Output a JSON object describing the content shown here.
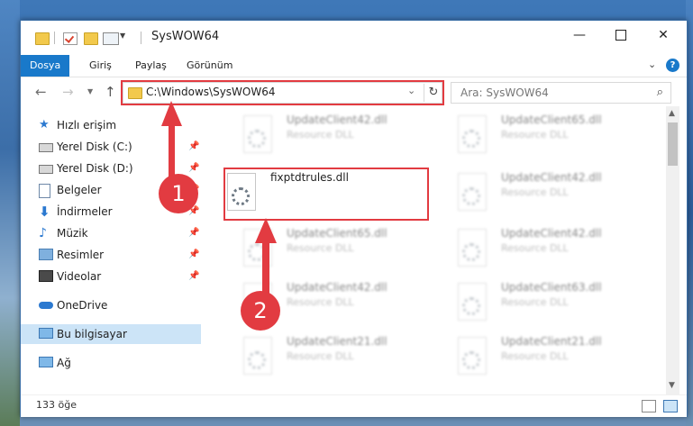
{
  "window": {
    "title": "SysWOW64",
    "minimize_icon": "minimize-icon",
    "maximize_icon": "maximize-icon",
    "close_icon": "close-icon"
  },
  "quick_access_toolbar": {
    "items": [
      "folder-icon",
      "properties-icon",
      "new-folder-icon",
      "customize-icon"
    ]
  },
  "ribbon": {
    "tabs": [
      "Dosya",
      "Giriş",
      "Paylaş",
      "Görünüm"
    ],
    "expand_icon": "chevron-down-icon",
    "help_label": "?"
  },
  "navigation": {
    "back_icon": "back-arrow-icon",
    "forward_icon": "forward-arrow-icon",
    "recent_icon": "chevron-down-icon",
    "up_icon": "up-arrow-icon",
    "address": "C:\\Windows\\SysWOW64",
    "refresh_icon": "refresh-icon",
    "search_placeholder": "Ara: SysWOW64"
  },
  "sidebar": {
    "items": [
      {
        "label": "Hızlı erişim",
        "icon": "star-icon",
        "pinned": false
      },
      {
        "label": "Yerel Disk (C:)",
        "icon": "drive-icon",
        "pinned": true
      },
      {
        "label": "Yerel Disk (D:)",
        "icon": "drive-icon",
        "pinned": true
      },
      {
        "label": "Belgeler",
        "icon": "documents-icon",
        "pinned": true
      },
      {
        "label": "İndirmeler",
        "icon": "download-icon",
        "pinned": true
      },
      {
        "label": "Müzik",
        "icon": "music-icon",
        "pinned": true
      },
      {
        "label": "Resimler",
        "icon": "pictures-icon",
        "pinned": true
      },
      {
        "label": "Videolar",
        "icon": "videos-icon",
        "pinned": true
      },
      {
        "label": "OneDrive",
        "icon": "cloud-icon",
        "pinned": false
      },
      {
        "label": "Bu bilgisayar",
        "icon": "computer-icon",
        "pinned": false,
        "selected": true
      },
      {
        "label": "Ağ",
        "icon": "network-icon",
        "pinned": false
      }
    ]
  },
  "files": [
    {
      "name": "UpdateClient42.dll",
      "type": "Resource DLL"
    },
    {
      "name": "UpdateClient65.dll",
      "type": "Resource DLL"
    },
    {
      "name": "fixptdtrules.dll",
      "type": ""
    },
    {
      "name": "UpdateClient42.dll",
      "type": "Resource DLL"
    },
    {
      "name": "UpdateClient65.dll",
      "type": "Resource DLL"
    },
    {
      "name": "UpdateClient42.dll",
      "type": "Resource DLL"
    },
    {
      "name": "UpdateClient42.dll",
      "type": "Resource DLL"
    },
    {
      "name": "UpdateClient63.dll",
      "type": "Resource DLL"
    },
    {
      "name": "UpdateClient21.dll",
      "type": "Resource DLL"
    },
    {
      "name": "UpdateClient21.dll",
      "type": "Resource DLL"
    }
  ],
  "status": {
    "item_count": "133 öğe"
  },
  "annotations": {
    "marker_1": "1",
    "marker_2": "2",
    "highlight_color": "#e23b41"
  }
}
